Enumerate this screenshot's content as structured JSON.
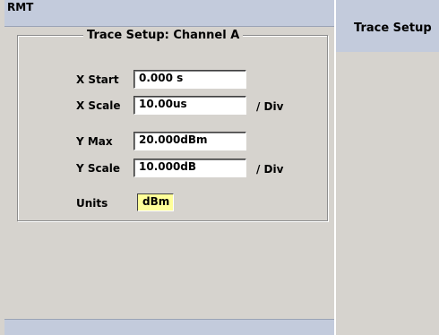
{
  "status": {
    "label": "RMT"
  },
  "softkey": {
    "title": "Trace Setup"
  },
  "group": {
    "title": "Trace Setup: Channel A"
  },
  "fields": {
    "x_start": {
      "label": "X Start",
      "value": "0.000 s"
    },
    "x_scale": {
      "label": "X Scale",
      "value": "10.00us",
      "unit": "/ Div"
    },
    "y_max": {
      "label": "Y Max",
      "value": "20.000dBm"
    },
    "y_scale": {
      "label": "Y Scale",
      "value": "10.000dB",
      "unit": "/ Div"
    },
    "units": {
      "label": "Units",
      "value": "dBm"
    }
  },
  "colors": {
    "panel": "#d6d3ce",
    "bar": "#c3cbdc",
    "highlight": "#ffff99"
  }
}
